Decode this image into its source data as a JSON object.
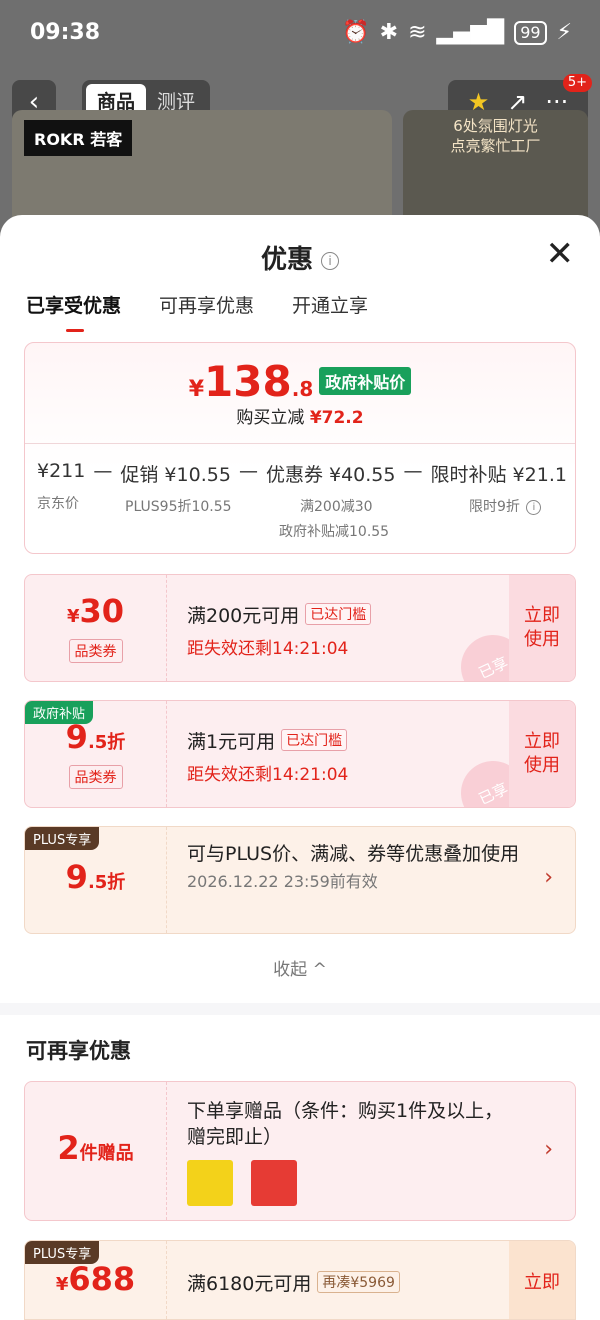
{
  "status": {
    "time": "09:38",
    "battery": "99"
  },
  "topnav": {
    "tab_goods": "商品",
    "tab_reviews": "测评",
    "badge": "5+"
  },
  "bg": {
    "brand": "ROKR 若客",
    "promo_line1": "6处氛围灯光",
    "promo_line2": "点亮繁忙工厂"
  },
  "sheet": {
    "title": "优惠",
    "tabs": [
      "已享受优惠",
      "可再享优惠",
      "开通立享"
    ]
  },
  "price": {
    "yen": "¥",
    "int": "138",
    "dec": ".8",
    "tag": "政府补贴价",
    "reduce_label": "购买立减",
    "reduce_value": "¥72.2",
    "jd_price": "¥211",
    "jd_label": "京东价",
    "minus": "—",
    "promo": "促销 ¥10.55",
    "promo_sub": "PLUS95折10.55",
    "coupon": "优惠券 ¥40.55",
    "coupon_sub1": "满200减30",
    "coupon_sub2": "政府补贴减10.55",
    "limited": "限时补贴 ¥21.1",
    "limited_sub": "限时9折"
  },
  "coupons": [
    {
      "amount_yen": "¥",
      "amount": "30",
      "cat": "品类券",
      "cond": "满200元可用",
      "met": "已达门槛",
      "expire": "距失效还剩14:21:04",
      "btn": "立即使用",
      "stamp": "已享"
    },
    {
      "corner": "政府补贴",
      "amount": "9",
      "amount_unit": ".5折",
      "cat": "品类券",
      "cond": "满1元可用",
      "met": "已达门槛",
      "expire": "距失效还剩14:21:04",
      "btn": "立即使用",
      "stamp": "已享"
    },
    {
      "corner": "PLUS专享",
      "amount": "9",
      "amount_unit": ".5折",
      "desc": "可与PLUS价、满减、券等优惠叠加使用",
      "expire": "2026.12.22 23:59前有效"
    }
  ],
  "collapse": "收起 ^",
  "section2": {
    "title": "可再享优惠",
    "gift": {
      "count": "2",
      "unit": "件赠品",
      "desc": "下单享赠品（条件：购买1件及以上，赠完即止）"
    },
    "plus": {
      "corner": "PLUS专享",
      "yen": "¥",
      "amount": "688",
      "cond": "满6180元可用",
      "tag": "再凑¥5969",
      "btn": "立即"
    }
  },
  "colors": {
    "accent": "#e2231a",
    "gov_green": "#19a05b",
    "plus_brown": "#5a3a26"
  }
}
